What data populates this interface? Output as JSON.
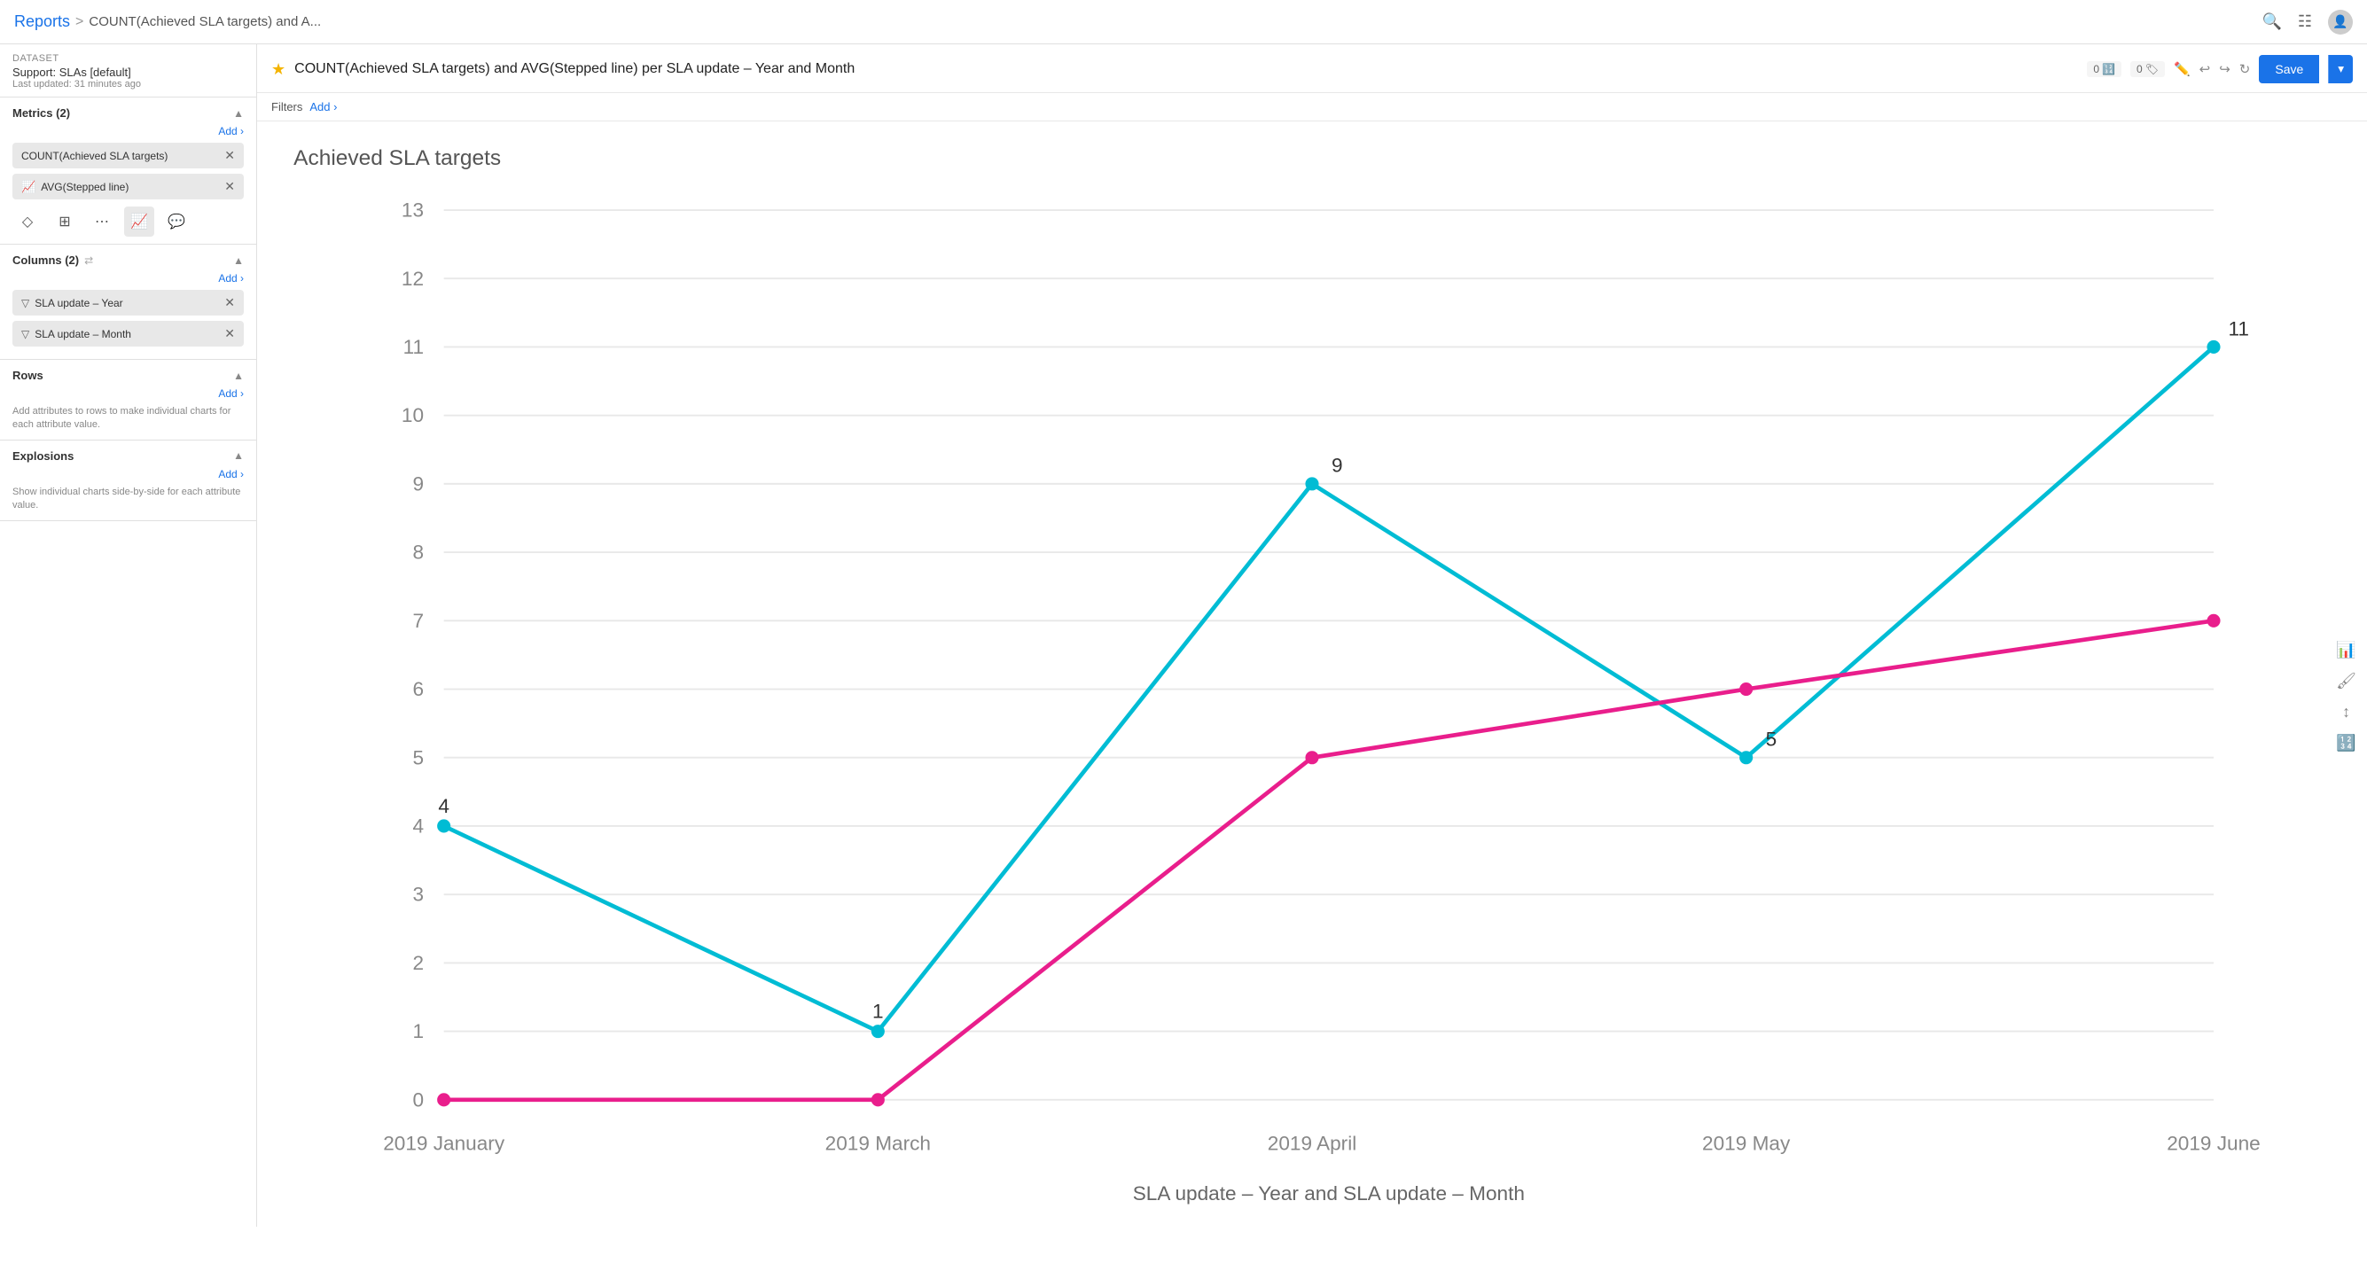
{
  "header": {
    "reports_label": "Reports",
    "separator": ">",
    "title": "COUNT(Achieved SLA targets) and A...",
    "icons": [
      "search",
      "grid",
      "user"
    ]
  },
  "chart_header": {
    "star": "★",
    "title": "COUNT(Achieved SLA targets) and AVG(Stepped line) per SLA update – Year and Month",
    "badge1_value": "0",
    "badge2_value": "0",
    "save_label": "Save"
  },
  "filters": {
    "label": "Filters",
    "add_label": "Add ›"
  },
  "sidebar": {
    "dataset_label": "Dataset",
    "dataset_name": "Support: SLAs [default]",
    "dataset_updated": "Last updated: 31 minutes ago",
    "metrics_section": {
      "title": "Metrics (2)",
      "add_label": "Add ›",
      "items": [
        {
          "label": "COUNT(Achieved SLA targets)",
          "icon": ""
        },
        {
          "label": "AVG(Stepped line)",
          "icon": "📈"
        }
      ]
    },
    "columns_section": {
      "title": "Columns (2)",
      "add_label": "Add ›",
      "items": [
        {
          "label": "SLA update – Year",
          "icon": "▽"
        },
        {
          "label": "SLA update – Month",
          "icon": "▽"
        }
      ]
    },
    "rows_section": {
      "title": "Rows",
      "add_label": "Add ›",
      "helper": "Add attributes to rows to make individual charts for each attribute value."
    },
    "explosions_section": {
      "title": "Explosions",
      "add_label": "Add ›",
      "helper": "Show individual charts side-by-side for each attribute value."
    }
  },
  "chart": {
    "y_label": "Achieved SLA targets",
    "x_label": "SLA update – Year and SLA update – Month",
    "y_max": 13,
    "y_ticks": [
      0,
      1,
      2,
      3,
      4,
      5,
      6,
      7,
      8,
      9,
      10,
      11,
      12,
      13
    ],
    "x_ticks": [
      "2019 January",
      "2019 March",
      "2019 April",
      "2019 May",
      "2019 June"
    ],
    "line1": {
      "color": "#00bcd4",
      "points": [
        {
          "x": 0,
          "y": 4,
          "label": "4"
        },
        {
          "x": 1,
          "y": 1,
          "label": "1"
        },
        {
          "x": 2,
          "y": 9,
          "label": "9"
        },
        {
          "x": 3,
          "y": 5,
          "label": "5"
        },
        {
          "x": 4,
          "y": 11,
          "label": "11"
        }
      ]
    },
    "line2": {
      "color": "#e91e8c",
      "points": [
        {
          "x": 0,
          "y": 0,
          "label": ""
        },
        {
          "x": 1,
          "y": 0,
          "label": ""
        },
        {
          "x": 2,
          "y": 5,
          "label": ""
        },
        {
          "x": 3,
          "y": 6,
          "label": ""
        },
        {
          "x": 4,
          "y": 7,
          "label": ""
        }
      ]
    }
  }
}
